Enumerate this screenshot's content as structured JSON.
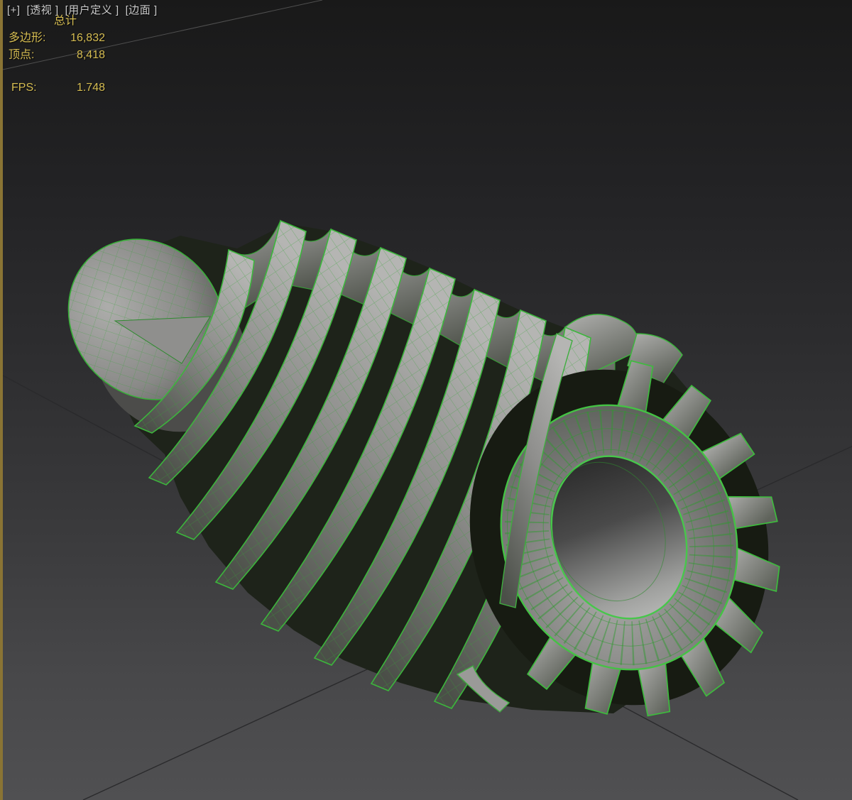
{
  "viewport": {
    "label_items": [
      {
        "id": "general-menu",
        "text": "[+]"
      },
      {
        "id": "point-of-view",
        "text": "[透视 ]"
      },
      {
        "id": "camera-user-defined",
        "text": "[用户定义 ]"
      },
      {
        "id": "shading-edged-faces",
        "text": "[边面 ]"
      }
    ],
    "active_border_color": "#8a7434"
  },
  "statistics": {
    "title": "总计",
    "rows": [
      {
        "label": "多边形:",
        "value": "16,832"
      },
      {
        "label": "顶点:",
        "value": "8,418"
      }
    ],
    "fps": {
      "label": "FPS:",
      "value": "1.748"
    },
    "text_color": "#d6bd52"
  },
  "scene": {
    "object": "helical-gear-editable-poly",
    "wireframe_color": "#3cbb3c",
    "surface_light": "#b3b3b1",
    "surface_dark": "#454943",
    "background_top": "#191919",
    "background_bottom": "#505052"
  }
}
